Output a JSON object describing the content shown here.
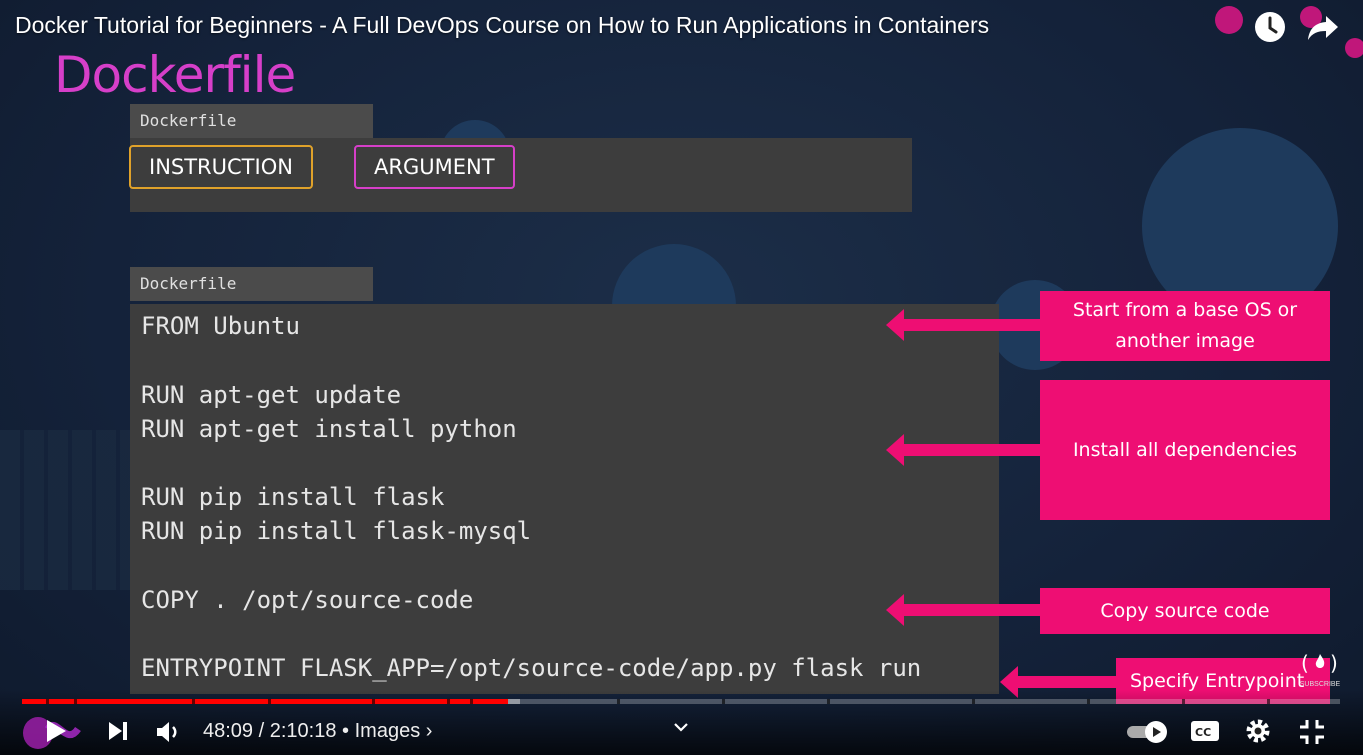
{
  "video": {
    "title": "Docker Tutorial for Beginners - A Full DevOps Course on How to Run Applications in Containers"
  },
  "slide": {
    "title": "Dockerfile",
    "syntax_box": {
      "tab_label": "Dockerfile",
      "instruction_chip": "INSTRUCTION",
      "argument_chip": "ARGUMENT",
      "instruction_color": "#e0a22a",
      "argument_color": "#d63fc9"
    },
    "code_box": {
      "tab_label": "Dockerfile",
      "lines": [
        "FROM Ubuntu",
        "RUN apt-get update",
        "RUN apt-get install python",
        "RUN pip install flask",
        "RUN pip install flask-mysql",
        "COPY . /opt/source-code",
        "ENTRYPOINT FLASK_APP=/opt/source-code/app.py flask run"
      ]
    },
    "callouts": [
      "Start from a base OS or another image",
      "Install all dependencies",
      "Copy source code",
      "Specify Entrypoint"
    ],
    "accent_color": "#ee0e73"
  },
  "watermark": {
    "label": "SUBSCRIBE"
  },
  "player": {
    "time_current": "48:09",
    "time_total": "2:10:18",
    "chapter": "Images",
    "progress_percent": 36.9,
    "buffered_percent": 37.8,
    "icons": {
      "play": "play-icon",
      "next": "next-icon",
      "volume": "volume-icon",
      "autoplay": "autoplay-toggle-icon",
      "captions": "captions-icon",
      "settings": "gear-icon",
      "fullscreen": "fullscreen-exit-icon",
      "watch_later": "clock-icon",
      "share": "share-icon"
    }
  }
}
